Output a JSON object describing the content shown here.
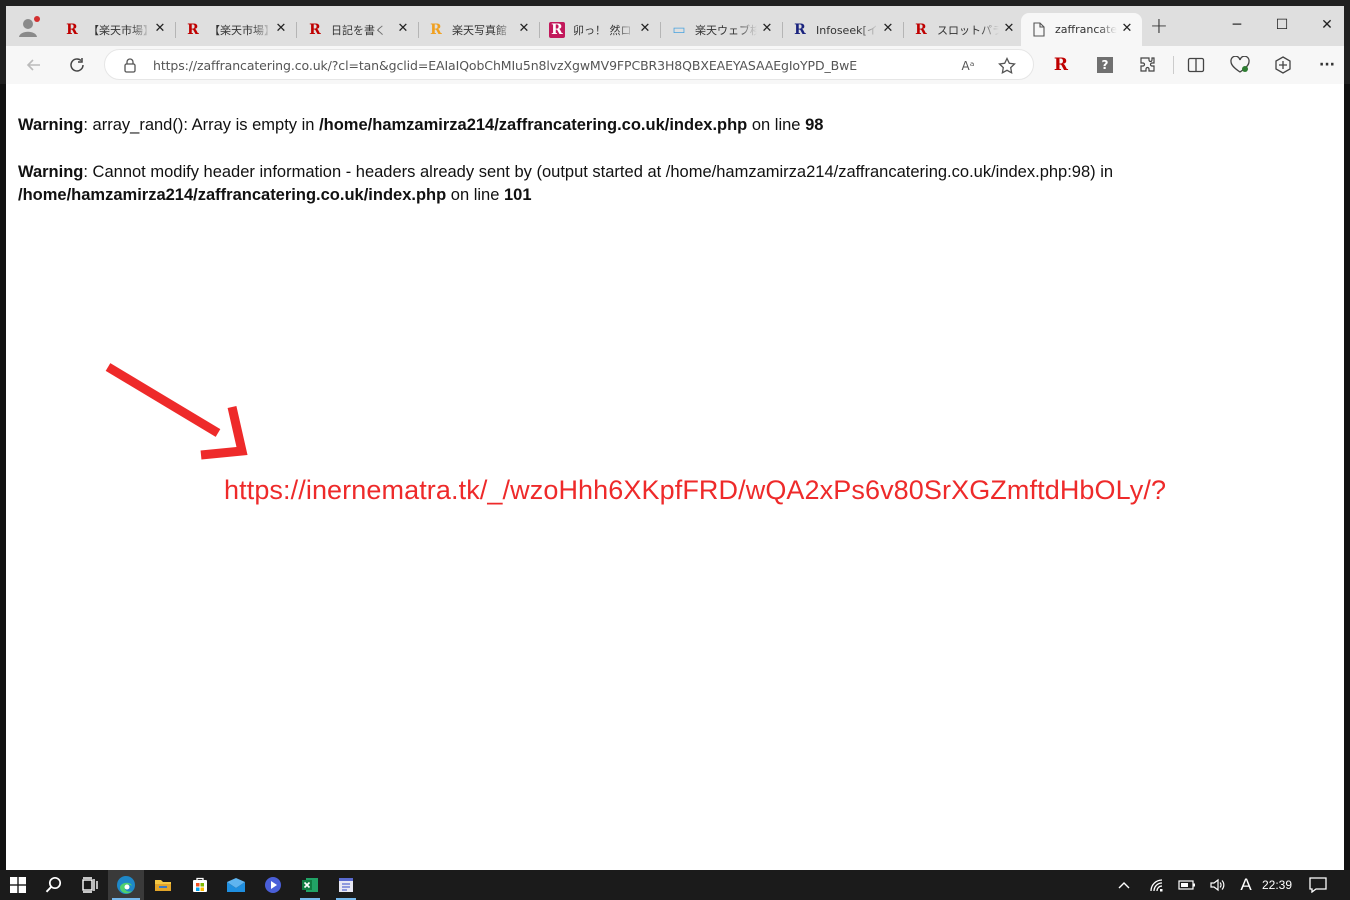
{
  "browser": {
    "tabs": [
      {
        "favicon": "R",
        "favicon_color": "#bf0000",
        "title": "【楽天市場】"
      },
      {
        "favicon": "R",
        "favicon_color": "#bf0000",
        "title": "【楽天市場】"
      },
      {
        "favicon": "R",
        "favicon_color": "#bf0000",
        "title": "日記を書く"
      },
      {
        "favicon": "R",
        "favicon_color": "#f0a020",
        "title": "楽天写真館"
      },
      {
        "favicon": "R",
        "favicon_color": "#ffffff",
        "favicon_bg": "#c2185b",
        "title": "卯っ！ 然ロ"
      },
      {
        "favicon": "▭",
        "favicon_color": "#4aa3df",
        "title": "楽天ウェブ検"
      },
      {
        "favicon": "R",
        "favicon_color": "#1a237e",
        "title": "Infoseek[イ"
      },
      {
        "favicon": "R",
        "favicon_color": "#bf0000",
        "title": "スロットパラダ"
      },
      {
        "favicon": "doc",
        "favicon_color": "#555555",
        "title": "zaffrancatering"
      }
    ],
    "close_glyph": "✕",
    "new_tab_glyph": "+",
    "window_controls": {
      "minimize": "─",
      "maximize": "☐",
      "close": "✕"
    },
    "address_bar": {
      "url": "https://zaffrancatering.co.uk/?cl=tan&gclid=EAIaIQobChMIu5n8lvzXgwMV9FPCBR3H8QBXEAEYASAAEgIoYPD_BwE"
    },
    "toolbar_icons": {
      "read_aloud": "Aᵃ",
      "rakuten_ext": "R",
      "help_ext": "?",
      "more": "···"
    }
  },
  "page": {
    "warning1": {
      "label": "Warning",
      "message": ": array_rand(): Array is empty in ",
      "path": "/home/hamzamirza214/zaffrancatering.co.uk/index.php",
      "on_line": " on line ",
      "line": "98"
    },
    "warning2": {
      "label": "Warning",
      "message": ": Cannot modify header information - headers already sent by (output started at /home/hamzamirza214/zaffrancatering.co.uk/index.php:98) in",
      "path": "/home/hamzamirza214/zaffrancatering.co.uk/index.php",
      "on_line": " on line ",
      "line": "101"
    },
    "annotation": {
      "url": "https://inernematra.tk/_/wzoHhh6XKpfFRD/wQA2xPs6v80SrXGZmftdHbOLy/?",
      "color": "#ee2a2a"
    }
  },
  "taskbar": {
    "apps": [
      "start",
      "search",
      "task-view",
      "edge",
      "file-explorer",
      "store",
      "mail",
      "media-player",
      "excel",
      "notepad-app"
    ],
    "ime": "A",
    "clock": "22:39"
  }
}
